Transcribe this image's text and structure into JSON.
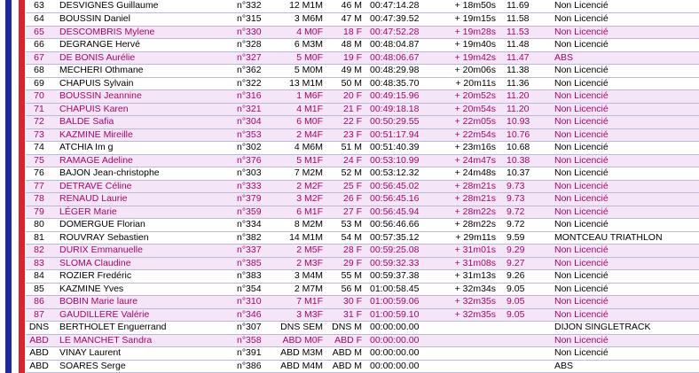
{
  "table": {
    "rows": [
      {
        "rank": "63",
        "name": "DESVIGNES Guillaume",
        "dossard": "n°332",
        "cat": "12 M1M",
        "place": "46 M",
        "time": "00:47:14.28",
        "gap": "+ 18m50s",
        "speed": "11.69",
        "club": "Non Licencié"
      },
      {
        "rank": "64",
        "name": "BOUSSIN Daniel",
        "dossard": "n°315",
        "cat": "3 M6M",
        "place": "47 M",
        "time": "00:47:39.52",
        "gap": "+ 19m15s",
        "speed": "11.58",
        "club": "Non Licencié"
      },
      {
        "rank": "65",
        "name": "DESCOMBRIS Mylene",
        "dossard": "n°330",
        "cat": "4 M0F",
        "place": "18 F",
        "time": "00:47:52.28",
        "gap": "+ 19m28s",
        "speed": "11.53",
        "club": "Non Licencié"
      },
      {
        "rank": "66",
        "name": "DEGRANGE Hervé",
        "dossard": "n°328",
        "cat": "6 M3M",
        "place": "48 M",
        "time": "00:48:04.87",
        "gap": "+ 19m40s",
        "speed": "11.48",
        "club": "Non Licencié"
      },
      {
        "rank": "67",
        "name": "DE BONIS Aurélie",
        "dossard": "n°327",
        "cat": "5 M0F",
        "place": "19 F",
        "time": "00:48:06.67",
        "gap": "+ 19m42s",
        "speed": "11.47",
        "club": "ABS"
      },
      {
        "rank": "68",
        "name": "MECHERI Othmane",
        "dossard": "n°362",
        "cat": "5 M0M",
        "place": "49 M",
        "time": "00:48:29.98",
        "gap": "+ 20m06s",
        "speed": "11.38",
        "club": "Non Licencié"
      },
      {
        "rank": "69",
        "name": "CHAPUIS Sylvain",
        "dossard": "n°322",
        "cat": "13 M1M",
        "place": "50 M",
        "time": "00:48:35.70",
        "gap": "+ 20m11s",
        "speed": "11.36",
        "club": "Non Licencié"
      },
      {
        "rank": "70",
        "name": "BOUSSIN Jeannine",
        "dossard": "n°316",
        "cat": "1 M6F",
        "place": "20 F",
        "time": "00:49:15.96",
        "gap": "+ 20m52s",
        "speed": "11.20",
        "club": "Non Licencié"
      },
      {
        "rank": "71",
        "name": "CHAPUIS Karen",
        "dossard": "n°321",
        "cat": "4 M1F",
        "place": "21 F",
        "time": "00:49:18.18",
        "gap": "+ 20m54s",
        "speed": "11.20",
        "club": "Non Licencié"
      },
      {
        "rank": "72",
        "name": "BALDE Safia",
        "dossard": "n°304",
        "cat": "6 M0F",
        "place": "22 F",
        "time": "00:50:29.55",
        "gap": "+ 22m05s",
        "speed": "10.93",
        "club": "Non Licencié"
      },
      {
        "rank": "73",
        "name": "KAZMINE Mireille",
        "dossard": "n°353",
        "cat": "2 M4F",
        "place": "23 F",
        "time": "00:51:17.94",
        "gap": "+ 22m54s",
        "speed": "10.76",
        "club": "Non Licencié"
      },
      {
        "rank": "74",
        "name": "ATCHIA Im g",
        "dossard": "n°302",
        "cat": "4 M6M",
        "place": "51 M",
        "time": "00:51:40.39",
        "gap": "+ 23m16s",
        "speed": "10.68",
        "club": "Non Licencié"
      },
      {
        "rank": "75",
        "name": "RAMAGE Adeline",
        "dossard": "n°376",
        "cat": "5 M1F",
        "place": "24 F",
        "time": "00:53:10.99",
        "gap": "+ 24m47s",
        "speed": "10.38",
        "club": "Non Licencié"
      },
      {
        "rank": "76",
        "name": "BAJON Jean-christophe",
        "dossard": "n°303",
        "cat": "7 M2M",
        "place": "52 M",
        "time": "00:53:12.32",
        "gap": "+ 24m48s",
        "speed": "10.37",
        "club": "Non Licencié"
      },
      {
        "rank": "77",
        "name": "DETRAVE Céline",
        "dossard": "n°333",
        "cat": "2 M2F",
        "place": "25 F",
        "time": "00:56:45.02",
        "gap": "+ 28m21s",
        "speed": "9.73",
        "club": "Non Licencié"
      },
      {
        "rank": "78",
        "name": "RENAUD Laurie",
        "dossard": "n°379",
        "cat": "3 M2F",
        "place": "26 F",
        "time": "00:56:45.16",
        "gap": "+ 28m21s",
        "speed": "9.73",
        "club": "Non Licencié"
      },
      {
        "rank": "79",
        "name": "LÉGER Marie",
        "dossard": "n°359",
        "cat": "6 M1F",
        "place": "27 F",
        "time": "00:56:45.94",
        "gap": "+ 28m22s",
        "speed": "9.72",
        "club": "Non Licencié"
      },
      {
        "rank": "80",
        "name": "DOMERGUE Florian",
        "dossard": "n°334",
        "cat": "8 M2M",
        "place": "53 M",
        "time": "00:56:46.66",
        "gap": "+ 28m22s",
        "speed": "9.72",
        "club": "Non Licencié"
      },
      {
        "rank": "81",
        "name": "ROUVRAY Sebastien",
        "dossard": "n°382",
        "cat": "14 M1M",
        "place": "54 M",
        "time": "00:57:35.12",
        "gap": "+ 29m11s",
        "speed": "9.59",
        "club": "MONTCEAU TRIATHLON"
      },
      {
        "rank": "82",
        "name": "DURIX Emmanuelle",
        "dossard": "n°337",
        "cat": "2 M5F",
        "place": "28 F",
        "time": "00:59:25.08",
        "gap": "+ 31m01s",
        "speed": "9.29",
        "club": "Non Licencié"
      },
      {
        "rank": "83",
        "name": "SLOMA Claudine",
        "dossard": "n°385",
        "cat": "2 M3F",
        "place": "29 F",
        "time": "00:59:32.33",
        "gap": "+ 31m08s",
        "speed": "9.27",
        "club": "Non Licencié"
      },
      {
        "rank": "84",
        "name": "ROZIER Fredéric",
        "dossard": "n°383",
        "cat": "3 M4M",
        "place": "55 M",
        "time": "00:59:37.38",
        "gap": "+ 31m13s",
        "speed": "9.26",
        "club": "Non Licencié"
      },
      {
        "rank": "85",
        "name": "KAZMINE Yves",
        "dossard": "n°354",
        "cat": "2 M7M",
        "place": "56 M",
        "time": "01:00:58.45",
        "gap": "+ 32m34s",
        "speed": "9.05",
        "club": "Non Licencié"
      },
      {
        "rank": "86",
        "name": "BOBIN Marie laure",
        "dossard": "n°310",
        "cat": "7 M1F",
        "place": "30 F",
        "time": "01:00:59.06",
        "gap": "+ 32m35s",
        "speed": "9.05",
        "club": "Non Licencié"
      },
      {
        "rank": "87",
        "name": "GAUDILLERE Valérie",
        "dossard": "n°346",
        "cat": "3 M3F",
        "place": "31 F",
        "time": "01:00:59.10",
        "gap": "+ 32m35s",
        "speed": "9.05",
        "club": "Non Licencié"
      },
      {
        "rank": "DNS",
        "name": "BERTHOLET Enguerrand",
        "dossard": "n°307",
        "cat": "DNS SEM",
        "place": "DNS M",
        "time": "00:00:00.00",
        "gap": "",
        "speed": "",
        "club": "DIJON SINGLETRACK"
      },
      {
        "rank": "ABD",
        "name": "LE MANCHET Sandra",
        "dossard": "n°358",
        "cat": "ABD M0F",
        "place": "ABD F",
        "time": "00:00:00.00",
        "gap": "",
        "speed": "",
        "club": "Non Licencié"
      },
      {
        "rank": "ABD",
        "name": "VINAY Laurent",
        "dossard": "n°391",
        "cat": "ABD M3M",
        "place": "ABD M",
        "time": "00:00:00.00",
        "gap": "",
        "speed": "",
        "club": "Non Licencié"
      },
      {
        "rank": "ABD",
        "name": "SOARES Serge",
        "dossard": "n°386",
        "cat": "ABD M4M",
        "place": "ABD M",
        "time": "00:00:00.00",
        "gap": "",
        "speed": "",
        "club": "ABS"
      }
    ]
  },
  "colors": {
    "flag_blue": "#1a2aa0",
    "flag_red": "#e0202a",
    "female_text": "#b0006e",
    "female_row_bg": "#f4e6f7",
    "male_text": "#000000"
  }
}
